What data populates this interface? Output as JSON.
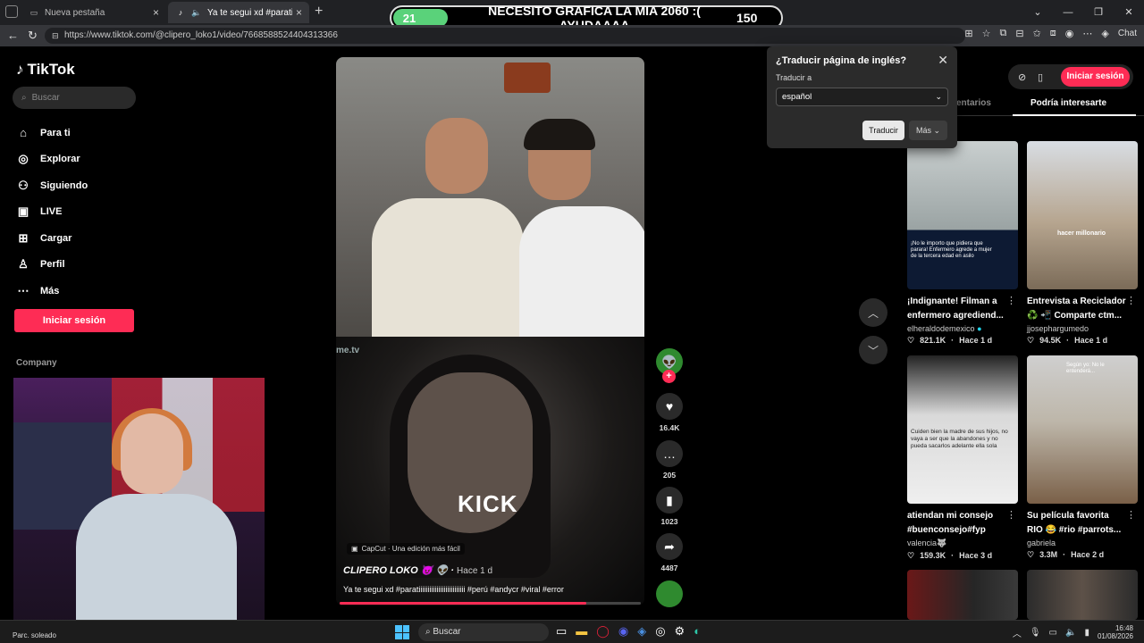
{
  "browser": {
    "tabs": [
      {
        "title": "Nueva pestaña",
        "active": false
      },
      {
        "title": "Ya te segui xd #paratiiiiiiiiiiiii",
        "active": true
      }
    ],
    "url": "https://www.tiktok.com/@clipero_loko1/video/7668588524404313366",
    "chat_label": "Chat"
  },
  "stream_goal": {
    "current": "21",
    "text": "NECESITO GRAFICA LA MIA 2060 :( AYUDAAAA",
    "goal": "150",
    "progress_fraction": 0.14
  },
  "tiktok": {
    "logo": "TikTok",
    "search_placeholder": "Buscar",
    "nav": [
      {
        "label": "Para ti",
        "icon": "home-icon"
      },
      {
        "label": "Explorar",
        "icon": "compass-icon"
      },
      {
        "label": "Siguiendo",
        "icon": "following-icon"
      },
      {
        "label": "LIVE",
        "icon": "live-icon"
      },
      {
        "label": "Cargar",
        "icon": "upload-icon"
      },
      {
        "label": "Perfil",
        "icon": "profile-icon"
      },
      {
        "label": "Más",
        "icon": "more-icon"
      }
    ],
    "login_label": "Iniciar sesión",
    "company_label": "Company"
  },
  "video": {
    "overlay_brand": "me.tv",
    "kick_text": "KICK",
    "capcut_label": "CapCut · Una edición más fácil",
    "author": "CLIPERO LOKO",
    "time": "Hace 1 d",
    "caption": "Ya te segui xd #paratiiiiiiiiiiiiiiiiiiiiiiiiii #perú #andycr #viral #error",
    "progress_fraction": 0.82,
    "likes": "16.4K",
    "comments": "205",
    "saves": "1023",
    "shares": "4487"
  },
  "translate_popup": {
    "title": "¿Traducir página de inglés?",
    "label": "Traducir a",
    "selected_language": "español",
    "translate_button": "Traducir",
    "more_button": "Más"
  },
  "right_panel": {
    "login_label": "Iniciar sesión",
    "tabs": [
      "entarios",
      "Podría interesarte"
    ],
    "cards": [
      {
        "title": "¡Indignante! Filman a enfermero agrediend...",
        "author": "elheraldodemexico",
        "views": "821.1K",
        "time": "Hace 1 d",
        "thumb_text": "¡No le importo que pidiera que parara! Enfermero agrede a mujer de la tercera edad en asilo"
      },
      {
        "title": "Entrevista a Reciclador ♻️ 📲 Comparte ctm...",
        "author": "jjosephargumedo",
        "views": "94.5K",
        "time": "Hace 1 d",
        "thumb_text": "hacer millonario"
      },
      {
        "title": "atiendan mi consejo #buenconsejo#fyp",
        "author": "valencia🐺",
        "views": "159.3K",
        "time": "Hace 3 d",
        "thumb_text": "Cuiden bien la madre de sus hijos, no vaya a ser que la abandones y no pueda sacarlos adelante ella sola"
      },
      {
        "title": "Su película favorita RIO 😂 #rio #parrots...",
        "author": "gabriela",
        "views": "3.3M",
        "time": "Hace 2 d",
        "thumb_text": "Según yo: No le entenderá..."
      }
    ]
  },
  "taskbar": {
    "weather": "Parc. soleado",
    "search_placeholder": "Buscar",
    "time": "16:48",
    "date": "01/08/2026"
  }
}
